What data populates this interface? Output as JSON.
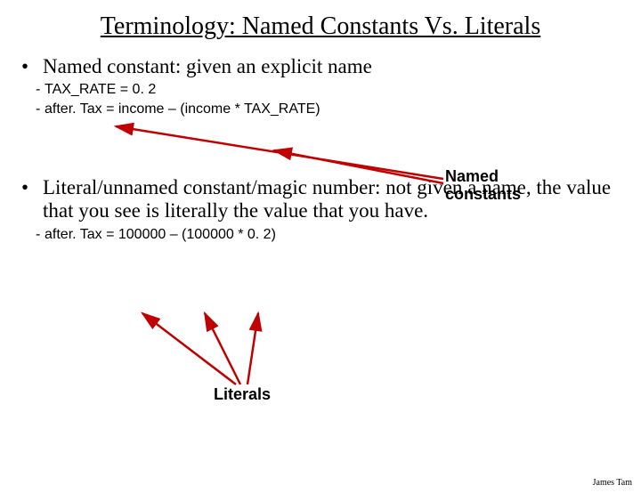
{
  "title": "Terminology: Named Constants Vs. Literals",
  "section1": {
    "heading": "Named constant: given an explicit name",
    "line1": "TAX_RATE = 0. 2",
    "line2": "after. Tax = income – (income * TAX_RATE)",
    "label": "Named constants"
  },
  "section2": {
    "heading": "Literal/unnamed constant/magic number: not given a name, the value that you see is literally the value that you have.",
    "line1": "after. Tax = 100000 – (100000 * 0. 2)",
    "label": "Literals"
  },
  "footer": "James Tam"
}
